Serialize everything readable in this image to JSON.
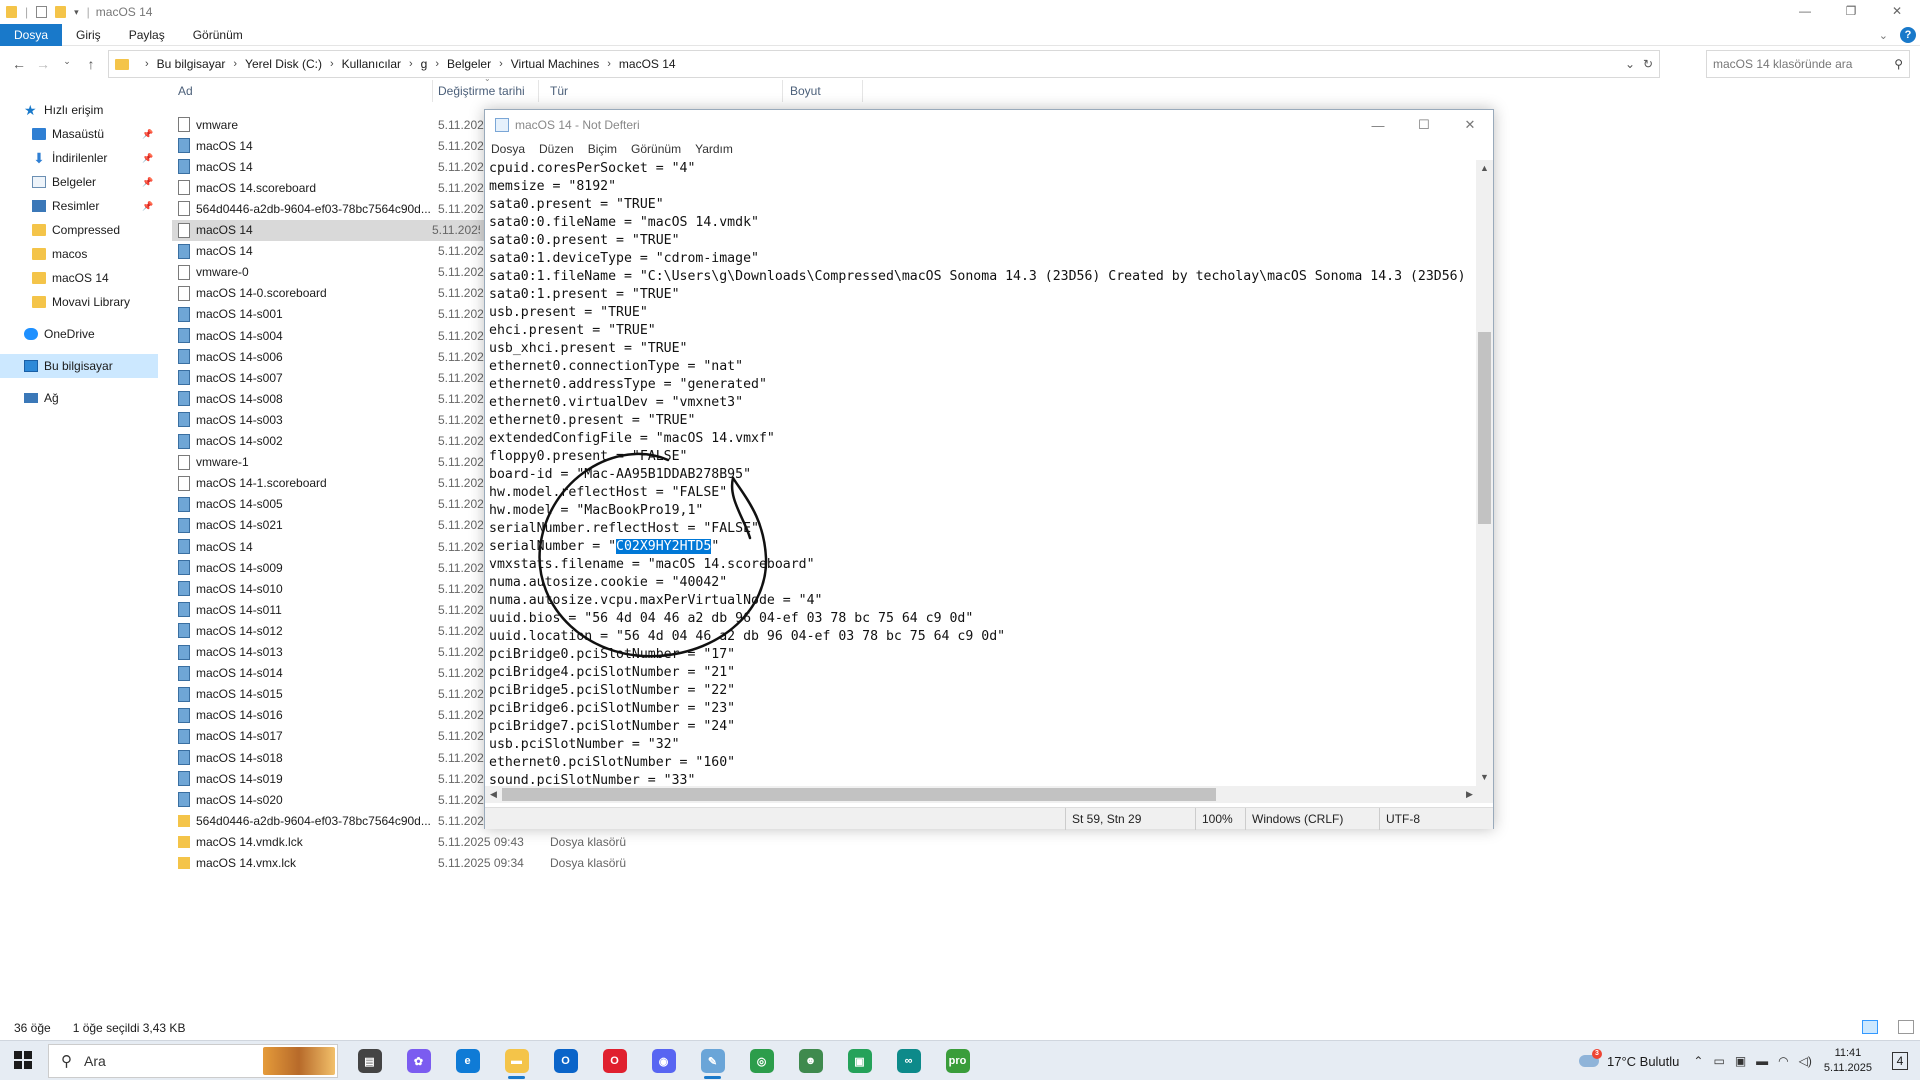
{
  "window": {
    "title": "macOS 14",
    "controls": {
      "minimize": "—",
      "maximize": "❐",
      "close": "✕"
    }
  },
  "ribbon": {
    "tabs": [
      "Dosya",
      "Giriş",
      "Paylaş",
      "Görünüm"
    ],
    "help": "?"
  },
  "address": {
    "breadcrumbs": [
      "Bu bilgisayar",
      "Yerel Disk (C:)",
      "Kullanıcılar",
      "g",
      "Belgeler",
      "Virtual Machines",
      "macOS 14"
    ],
    "search_placeholder": "macOS 14 klasöründe ara"
  },
  "sidebar": {
    "quick_access": "Hızlı erişim",
    "items": [
      {
        "label": "Masaüstü",
        "icon": "desktop-icon",
        "pinned": true
      },
      {
        "label": "İndirilenler",
        "icon": "download-icon",
        "pinned": true
      },
      {
        "label": "Belgeler",
        "icon": "documents-icon",
        "pinned": true
      },
      {
        "label": "Resimler",
        "icon": "pictures-icon",
        "pinned": true
      },
      {
        "label": "Compressed",
        "icon": "folder-icon",
        "pinned": false
      },
      {
        "label": "macos",
        "icon": "folder-icon",
        "pinned": false
      },
      {
        "label": "macOS 14",
        "icon": "folder-icon",
        "pinned": false
      },
      {
        "label": "Movavi Library",
        "icon": "folder-icon",
        "pinned": false
      }
    ],
    "onedrive": "OneDrive",
    "this_pc": "Bu bilgisayar",
    "network": "Ağ"
  },
  "columns": {
    "name": "Ad",
    "date": "Değiştirme tarihi",
    "type": "Tür",
    "size": "Boyut"
  },
  "files": [
    {
      "name": "vmware",
      "date": "5.11.2025",
      "icon": "file"
    },
    {
      "name": "macOS 14",
      "date": "5.11.2025",
      "icon": "disk"
    },
    {
      "name": "macOS 14",
      "date": "5.11.2025",
      "icon": "disk"
    },
    {
      "name": "macOS 14.scoreboard",
      "date": "5.11.2025",
      "icon": "file"
    },
    {
      "name": "564d0446-a2db-9604-ef03-78bc7564c90d...",
      "date": "5.11.2025",
      "icon": "file"
    },
    {
      "name": "macOS 14",
      "date": "5.11.2025",
      "icon": "file",
      "selected": true
    },
    {
      "name": "macOS 14",
      "date": "5.11.2025",
      "icon": "disk"
    },
    {
      "name": "vmware-0",
      "date": "5.11.2025",
      "icon": "file"
    },
    {
      "name": "macOS 14-0.scoreboard",
      "date": "5.11.2025",
      "icon": "file"
    },
    {
      "name": "macOS 14-s001",
      "date": "5.11.2025",
      "icon": "disk"
    },
    {
      "name": "macOS 14-s004",
      "date": "5.11.2025",
      "icon": "disk"
    },
    {
      "name": "macOS 14-s006",
      "date": "5.11.2025",
      "icon": "disk"
    },
    {
      "name": "macOS 14-s007",
      "date": "5.11.2025",
      "icon": "disk"
    },
    {
      "name": "macOS 14-s008",
      "date": "5.11.2025",
      "icon": "disk"
    },
    {
      "name": "macOS 14-s003",
      "date": "5.11.2025",
      "icon": "disk"
    },
    {
      "name": "macOS 14-s002",
      "date": "5.11.2025",
      "icon": "disk"
    },
    {
      "name": "vmware-1",
      "date": "5.11.2025",
      "icon": "file"
    },
    {
      "name": "macOS 14-1.scoreboard",
      "date": "5.11.2025",
      "icon": "file"
    },
    {
      "name": "macOS 14-s005",
      "date": "5.11.2025",
      "icon": "disk"
    },
    {
      "name": "macOS 14-s021",
      "date": "5.11.2025",
      "icon": "disk"
    },
    {
      "name": "macOS 14",
      "date": "5.11.2025",
      "icon": "disk"
    },
    {
      "name": "macOS 14-s009",
      "date": "5.11.2025",
      "icon": "disk"
    },
    {
      "name": "macOS 14-s010",
      "date": "5.11.2025",
      "icon": "disk"
    },
    {
      "name": "macOS 14-s011",
      "date": "5.11.2025",
      "icon": "disk"
    },
    {
      "name": "macOS 14-s012",
      "date": "5.11.2025",
      "icon": "disk"
    },
    {
      "name": "macOS 14-s013",
      "date": "5.11.2025",
      "icon": "disk"
    },
    {
      "name": "macOS 14-s014",
      "date": "5.11.2025",
      "icon": "disk"
    },
    {
      "name": "macOS 14-s015",
      "date": "5.11.2025",
      "icon": "disk"
    },
    {
      "name": "macOS 14-s016",
      "date": "5.11.2025",
      "icon": "disk"
    },
    {
      "name": "macOS 14-s017",
      "date": "5.11.2025",
      "icon": "disk"
    },
    {
      "name": "macOS 14-s018",
      "date": "5.11.2025",
      "icon": "disk"
    },
    {
      "name": "macOS 14-s019",
      "date": "5.11.2025",
      "icon": "disk"
    },
    {
      "name": "macOS 14-s020",
      "date": "5.11.2025",
      "icon": "disk"
    },
    {
      "name": "564d0446-a2db-9604-ef03-78bc7564c90d...",
      "date": "5.11.2025",
      "icon": "folder"
    },
    {
      "name": "macOS 14.vmdk.lck",
      "date": "5.11.2025 09:43",
      "type": "Dosya klasörü",
      "icon": "folder"
    },
    {
      "name": "macOS 14.vmx.lck",
      "date": "5.11.2025 09:34",
      "type": "Dosya klasörü",
      "icon": "folder"
    }
  ],
  "status": {
    "count": "36 öğe",
    "selected": "1 öğe seçildi  3,43 KB"
  },
  "notepad": {
    "title": "macOS 14 - Not Defteri",
    "menu": [
      "Dosya",
      "Düzen",
      "Biçim",
      "Görünüm",
      "Yardım"
    ],
    "lines": [
      "cpuid.coresPerSocket = \"4\"",
      "memsize = \"8192\"",
      "sata0.present = \"TRUE\"",
      "sata0:0.fileName = \"macOS 14.vmdk\"",
      "sata0:0.present = \"TRUE\"",
      "sata0:1.deviceType = \"cdrom-image\"",
      "sata0:1.fileName = \"C:\\Users\\g\\Downloads\\Compressed\\macOS Sonoma 14.3 (23D56) Created by techolay\\macOS Sonoma 14.3 (23D56)",
      "sata0:1.present = \"TRUE\"",
      "usb.present = \"TRUE\"",
      "ehci.present = \"TRUE\"",
      "usb_xhci.present = \"TRUE\"",
      "ethernet0.connectionType = \"nat\"",
      "ethernet0.addressType = \"generated\"",
      "ethernet0.virtualDev = \"vmxnet3\"",
      "ethernet0.present = \"TRUE\"",
      "extendedConfigFile = \"macOS 14.vmxf\"",
      "floppy0.present = \"FALSE\"",
      "board-id = \"Mac-AA95B1DDAB278B95\"",
      "hw.model.reflectHost = \"FALSE\"",
      "hw.model = \"MacBookPro19,1\"",
      "serialNumber.reflectHost = \"FALSE\"",
      "SERIAL_LINE",
      "vmxstats.filename = \"macOS 14.scoreboard\"",
      "numa.autosize.cookie = \"40042\"",
      "numa.autosize.vcpu.maxPerVirtualNode = \"4\"",
      "uuid.bios = \"56 4d 04 46 a2 db 96 04-ef 03 78 bc 75 64 c9 0d\"",
      "uuid.location = \"56 4d 04 46 a2 db 96 04-ef 03 78 bc 75 64 c9 0d\"",
      "pciBridge0.pciSlotNumber = \"17\"",
      "pciBridge4.pciSlotNumber = \"21\"",
      "pciBridge5.pciSlotNumber = \"22\"",
      "pciBridge6.pciSlotNumber = \"23\"",
      "pciBridge7.pciSlotNumber = \"24\"",
      "usb.pciSlotNumber = \"32\"",
      "ethernet0.pciSlotNumber = \"160\"",
      "sound.pciSlotNumber = \"33\""
    ],
    "serial_prefix": "serialNumber = \"",
    "serial_value": "C02X9HY2HTD5",
    "serial_suffix": "\"",
    "status": {
      "position": "St 59, Stn 29",
      "zoom": "100%",
      "eol": "Windows (CRLF)",
      "encoding": "UTF-8"
    }
  },
  "taskbar": {
    "search": "Ara",
    "weather": "17°C  Bulutlu",
    "weather_badge": "3",
    "time": "11:41",
    "date": "5.11.2025",
    "notif_count": "4",
    "apps": [
      {
        "name": "task-view",
        "color": "#444444",
        "glyph": "▤"
      },
      {
        "name": "copilot",
        "color": "#7b5cf0",
        "glyph": "✿"
      },
      {
        "name": "edge",
        "color": "#0f7bd6",
        "glyph": "e"
      },
      {
        "name": "file-explorer",
        "color": "#f4c449",
        "glyph": "▬",
        "active": true
      },
      {
        "name": "outlook",
        "color": "#0a64c9",
        "glyph": "O"
      },
      {
        "name": "opera",
        "color": "#e0202e",
        "glyph": "O"
      },
      {
        "name": "discord",
        "color": "#5865f2",
        "glyph": "◉"
      },
      {
        "name": "notepad",
        "color": "#6aa5d8",
        "glyph": "✎",
        "active": true
      },
      {
        "name": "chrome",
        "color": "#2c9d4b",
        "glyph": "◎"
      },
      {
        "name": "game-character",
        "color": "#3f8a4e",
        "glyph": "☻"
      },
      {
        "name": "camtasia",
        "color": "#25a25a",
        "glyph": "▣"
      },
      {
        "name": "arduino",
        "color": "#0d8a8a",
        "glyph": "∞"
      },
      {
        "name": "profile-app",
        "color": "#3a9d3a",
        "glyph": "pro"
      }
    ]
  },
  "colors": {
    "accent": "#1979ca",
    "selection": "#0078d7"
  }
}
